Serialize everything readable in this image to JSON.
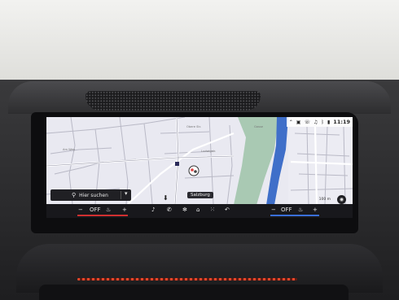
{
  "statusbar": {
    "time": "11:19",
    "icons": [
      "chevron-up-icon",
      "tablet-icon",
      "phone-icon",
      "music-icon",
      "bluetooth-icon",
      "signal-icon"
    ]
  },
  "map": {
    "search_label": "Hier suchen",
    "place_label": "Salzburg",
    "scale_label": "100 m",
    "street_labels": [
      "Obere Str.",
      "Am Weg",
      "Ludwigstr.",
      "Gasse"
    ]
  },
  "climate": {
    "left_minus": "−",
    "left_value": "OFF",
    "left_plus": "+",
    "right_minus": "−",
    "right_value": "OFF",
    "right_plus": "+"
  },
  "colors": {
    "water": "#3f6fc9",
    "park": "#a9c9b3",
    "road": "#ffffff",
    "left_zone": "#d03030",
    "right_zone": "#3a6fd8"
  }
}
